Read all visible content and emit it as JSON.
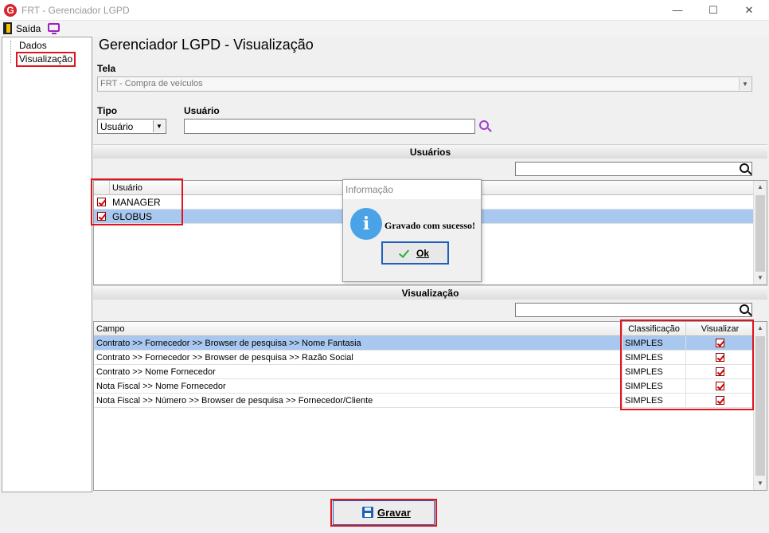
{
  "window": {
    "title": "FRT - Gerenciador LGPD",
    "logo_letter": "G",
    "minimize": "—",
    "maximize": "☐",
    "close": "✕"
  },
  "toolbar": {
    "exit_label": "Saída"
  },
  "sidebar": {
    "items": [
      {
        "label": "Dados"
      },
      {
        "label": "Visualização",
        "selected": true
      }
    ]
  },
  "header": {
    "title": "Gerenciador LGPD - Visualização"
  },
  "form": {
    "tela_label": "Tela",
    "tela_value": "FRT - Compra de veículos",
    "tipo_label": "Tipo",
    "tipo_value": "Usuário",
    "usuario_label": "Usuário",
    "usuario_value": ""
  },
  "users_section": {
    "title": "Usuários",
    "search_value": "",
    "columns": [
      "Usuário"
    ],
    "rows": [
      {
        "checked": true,
        "name": "MANAGER",
        "selected": false
      },
      {
        "checked": true,
        "name": "GLOBUS",
        "selected": true
      }
    ]
  },
  "visualization_section": {
    "title": "Visualização",
    "search_value": "",
    "columns": [
      "Campo",
      "Classificação",
      "Visualizar"
    ],
    "rows": [
      {
        "campo": "Contrato >> Fornecedor >> Browser de pesquisa >> Nome Fantasia",
        "classificacao": "SIMPLES",
        "visualizar": true,
        "selected": true
      },
      {
        "campo": "Contrato >> Fornecedor >> Browser de pesquisa >> Razão Social",
        "classificacao": "SIMPLES",
        "visualizar": true,
        "selected": false
      },
      {
        "campo": "Contrato >> Nome Fornecedor",
        "classificacao": "SIMPLES",
        "visualizar": true,
        "selected": false
      },
      {
        "campo": "Nota Fiscal  >> Nome Fornecedor",
        "classificacao": "SIMPLES",
        "visualizar": true,
        "selected": false
      },
      {
        "campo": "Nota Fiscal >> Número  >> Browser de pesquisa >> Fornecedor/Cliente",
        "classificacao": "SIMPLES",
        "visualizar": true,
        "selected": false
      }
    ]
  },
  "dialog": {
    "title": "Informação",
    "icon_letter": "i",
    "message": "Gravado com sucesso!",
    "ok_label": "Ok"
  },
  "footer": {
    "save_label": "Gravar"
  },
  "colors": {
    "highlight_border": "#e0141e",
    "selected_row": "#a8c8f0",
    "info_icon": "#4aa3e6",
    "check_red": "#d00000"
  }
}
